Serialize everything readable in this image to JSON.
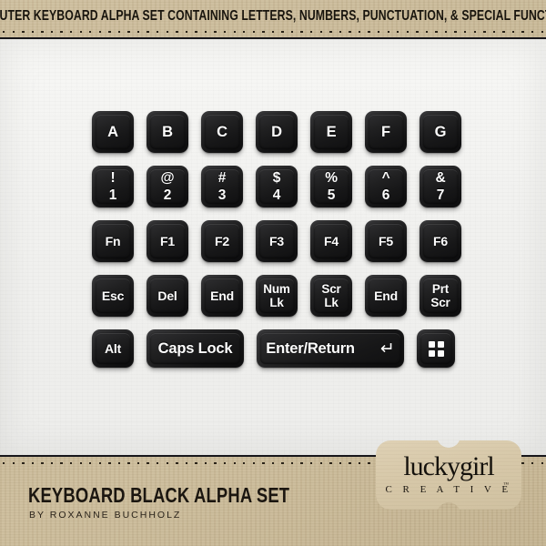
{
  "header": {
    "title": "Computer Keyboard Alpha Set Containing Letters, Numbers, Punctuation, & Special Functions"
  },
  "footer": {
    "title": "Keyboard Black Alpha Set",
    "subtitle": "by Roxanne Buchholz"
  },
  "logo": {
    "main": "luckygirl",
    "sub": "C R E A T I V E",
    "tm": "™"
  },
  "colors": {
    "kraft": "#c9b998",
    "paper": "#f2f2f0",
    "key_dark": "#17171a",
    "key_text": "#fdfdfd",
    "rule": "#17161a",
    "logo_plaque": "#d8c9a9"
  },
  "keyboard": {
    "rows": [
      {
        "name": "letters",
        "keys": [
          {
            "primary": "A",
            "type": "single"
          },
          {
            "primary": "B",
            "type": "single"
          },
          {
            "primary": "C",
            "type": "single"
          },
          {
            "primary": "D",
            "type": "single"
          },
          {
            "primary": "E",
            "type": "single"
          },
          {
            "primary": "F",
            "type": "single"
          },
          {
            "primary": "G",
            "type": "single"
          }
        ]
      },
      {
        "name": "numbers-symbols",
        "keys": [
          {
            "top": "!",
            "bottom": "1",
            "type": "dual"
          },
          {
            "top": "@",
            "bottom": "2",
            "type": "dual"
          },
          {
            "top": "#",
            "bottom": "3",
            "type": "dual"
          },
          {
            "top": "$",
            "bottom": "4",
            "type": "dual"
          },
          {
            "top": "%",
            "bottom": "5",
            "type": "dual"
          },
          {
            "top": "^",
            "bottom": "6",
            "type": "dual"
          },
          {
            "top": "&",
            "bottom": "7",
            "type": "dual"
          }
        ]
      },
      {
        "name": "function-keys",
        "keys": [
          {
            "primary": "Fn",
            "type": "small"
          },
          {
            "primary": "F1",
            "type": "small"
          },
          {
            "primary": "F2",
            "type": "small"
          },
          {
            "primary": "F3",
            "type": "small"
          },
          {
            "primary": "F4",
            "type": "small"
          },
          {
            "primary": "F5",
            "type": "small"
          },
          {
            "primary": "F6",
            "type": "small"
          }
        ]
      },
      {
        "name": "special-keys",
        "keys": [
          {
            "primary": "Esc",
            "type": "small"
          },
          {
            "primary": "Del",
            "type": "small"
          },
          {
            "primary": "End",
            "type": "small"
          },
          {
            "top": "Num",
            "bottom": "Lk",
            "type": "stack"
          },
          {
            "top": "Scr",
            "bottom": "Lk",
            "type": "stack"
          },
          {
            "primary": "End",
            "type": "small"
          },
          {
            "top": "Prt",
            "bottom": "Scr",
            "type": "stack"
          }
        ]
      },
      {
        "name": "modifier-keys",
        "keys": [
          {
            "primary": "Alt",
            "type": "small",
            "width": "alt"
          },
          {
            "primary": "Caps Lock",
            "type": "single",
            "width": "caps"
          },
          {
            "primary": "Enter/Return",
            "type": "enter",
            "width": "enter",
            "glyph": "↵"
          },
          {
            "primary": "",
            "type": "win",
            "width": "win",
            "icon": "windows-grid-icon"
          }
        ]
      }
    ]
  }
}
